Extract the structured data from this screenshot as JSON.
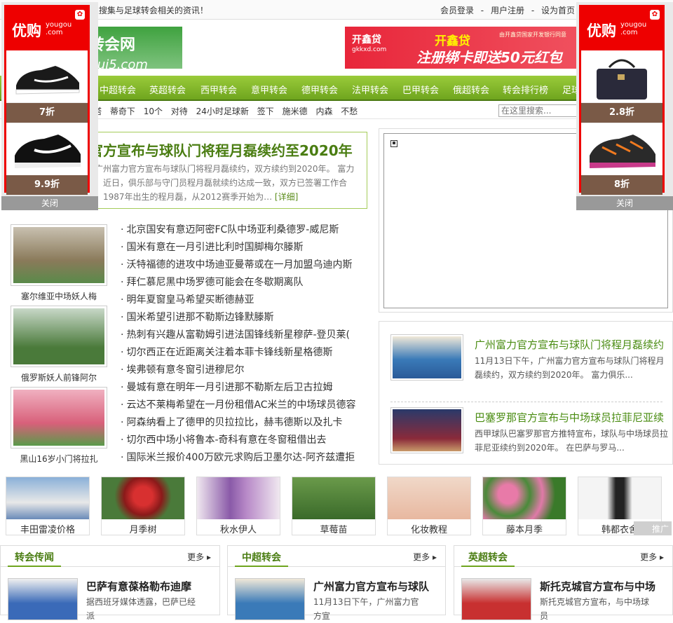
{
  "topbar": {
    "slogan": "5.Com），专业搜集与足球转会相关的资讯！",
    "login": "会员登录",
    "register": "用户注册",
    "homepage": "设为首页"
  },
  "logo": {
    "text": "球转会网",
    "sub": "anhui5.com"
  },
  "banner": {
    "brand": "开鑫贷",
    "brand_url": "gkkxd.com",
    "line1": "开鑫贷",
    "line2": "注册绑卡即送50元红包",
    "small": "由开鑫贷国家开发银行同意"
  },
  "nav": [
    "中超转会",
    "英超转会",
    "西甲转会",
    "意甲转会",
    "德甲转会",
    "法甲转会",
    "巴甲转会",
    "俄超转会",
    "转会排行榜",
    "足球"
  ],
  "tags": [
    "塔",
    "蒂奇下",
    "10个",
    "对待",
    "24小时足球新",
    "签下",
    "施米德",
    "内森",
    "不愁"
  ],
  "search_placeholder": "在这里搜索...",
  "headline": {
    "title": "官方宣布与球队门将程月磊续约至2020年",
    "summary_lines": [
      "广州富力官方宣布与球队门将程月磊续约，双方续约到2020年。 富力",
      "，近日，俱乐部与守门员程月磊就续约达成一致，双方已签署工作合",
      "，1987年出生的程月磊，从2012赛季开始为…"
    ],
    "more": "[详细]"
  },
  "thumbs": [
    {
      "caption": "塞尔维亚中场妖人梅",
      "color": "#8a7a5a"
    },
    {
      "caption": "俄罗斯妖人前锋阿尔",
      "color": "#4a7a3a"
    },
    {
      "caption": "黑山16岁小门将拉扎",
      "color": "#d8607a"
    }
  ],
  "newslist": [
    "北京国安有意迈阿密FC队中场亚利桑德罗-威尼斯",
    "国米有意在一月引进比利时国脚梅尔滕斯",
    "沃特福德的进攻中场迪亚曼蒂或在一月加盟乌迪内斯",
    "拜仁慕尼黑中场罗德可能会在冬歇期离队",
    "明年夏窗皇马希望买断德赫亚",
    "国米希望引进那不勒斯边锋默滕斯",
    "热刺有兴趣从富勒姆引进法国锋线新星穆萨-登贝莱(",
    "切尔西正在近距离关注着本菲卡锋线新星格德斯",
    "埃弗顿有意冬窗引进穆尼尔",
    "曼城有意在明年一月引进那不勒斯左后卫古拉姆",
    "云达不莱梅希望在一月份租借AC米兰的中场球员德容",
    "阿森纳看上了德甲的贝拉拉比，赫韦德斯以及扎卡",
    "切尔西中场小将鲁本-奇科有意在冬窗租借出去",
    "国际米兰报价400万欧元求购后卫墨尔达-阿齐兹遭拒"
  ],
  "sidenews": [
    {
      "title": "广州富力官方宣布与球队门将程月磊续约",
      "desc": "11月13日下午，广州富力官方宣布与球队门将程月磊续约，双方续约到2020年。 富力俱乐...",
      "color": "#3a7ab8"
    },
    {
      "title": "巴塞罗那官方宣布与中场球员拉菲尼亚续",
      "desc": "西甲球队巴塞罗那官方推特宣布，球队与中场球员拉菲尼亚续约到2020年。 在巴萨与罗马...",
      "color": "#8a2a3a"
    }
  ],
  "gallery": [
    {
      "caption": "丰田雷凌价格",
      "color": "#6a8ab8"
    },
    {
      "caption": "月季树",
      "color": "#b83030"
    },
    {
      "caption": "秋水伊人",
      "color": "#8a5aa8"
    },
    {
      "caption": "草莓苗",
      "color": "#4a7a3a"
    },
    {
      "caption": "化妆教程",
      "color": "#e8c8b8"
    },
    {
      "caption": "藤本月季",
      "color": "#e07aa8"
    },
    {
      "caption": "韩都衣舍",
      "color": "#e8e8e8"
    }
  ],
  "tui": "推广",
  "columns": [
    {
      "title": "转会传闻",
      "more": "更多 ▸",
      "headline": "巴萨有意葆格勒布迪摩",
      "desc": "据西班牙媒体透露，巴萨已经派",
      "color": "#3a6ab8"
    },
    {
      "title": "中超转会",
      "more": "更多 ▸",
      "headline": "广州富力官方宣布与球队",
      "desc": "11月13日下午，广州富力官方宣",
      "color": "#3a7ab8"
    },
    {
      "title": "英超转会",
      "more": "更多 ▸",
      "headline": "斯托克城官方宣布与中场",
      "desc": "斯托克城官方宣布，与中场球员",
      "color": "#c83030"
    }
  ],
  "ads": {
    "brand": "优购",
    "brand_url": "yougou .com",
    "left": {
      "discount1": "7折",
      "discount2": "9.9折",
      "close": "关闭"
    },
    "right": {
      "discount1": "2.8折",
      "discount2": "8折",
      "close": "关闭"
    }
  }
}
